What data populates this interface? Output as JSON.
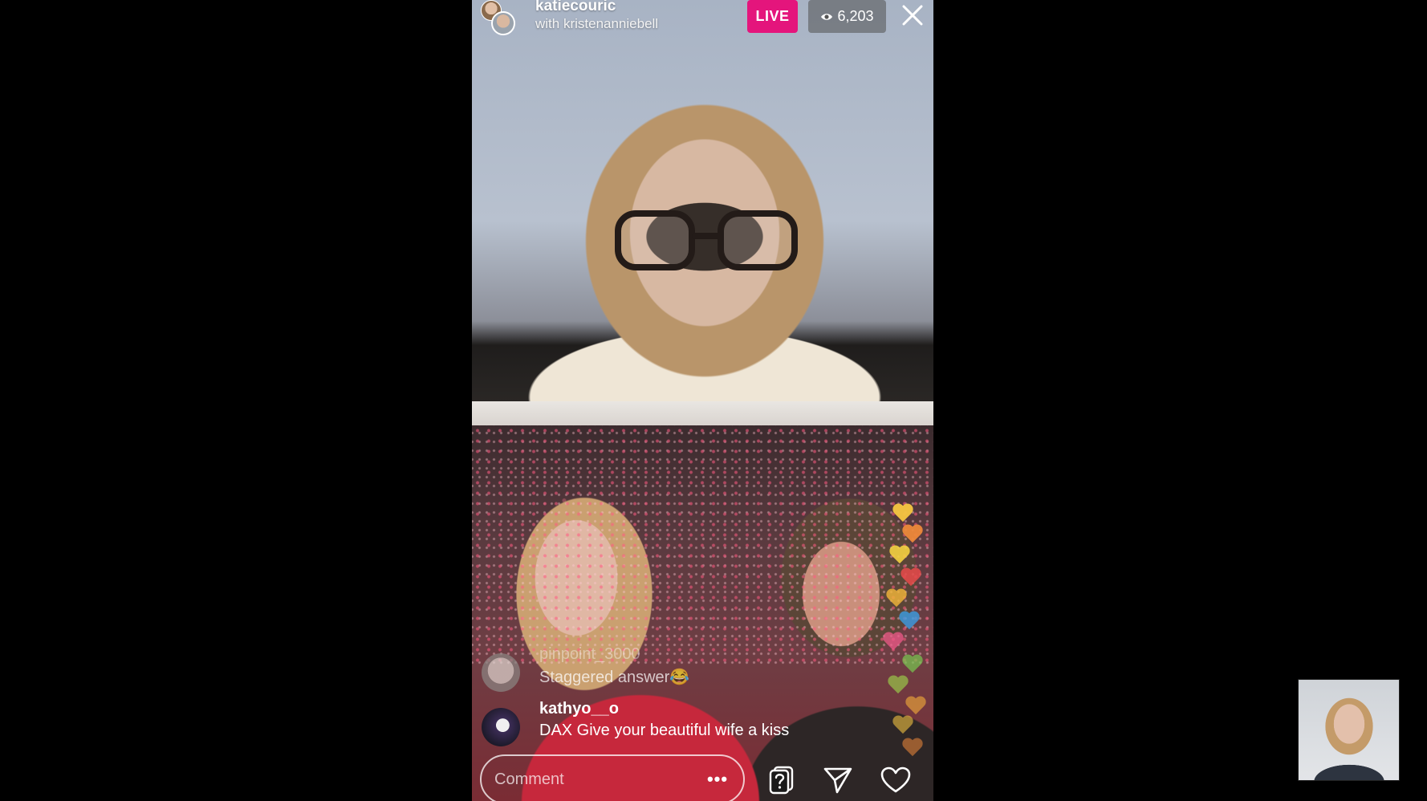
{
  "stream": {
    "host_username": "katiecouric",
    "with_line": "with kristenanniebell",
    "live_label": "LIVE",
    "viewer_count": "6,203"
  },
  "comments": [
    {
      "username": "pinpoint_3000",
      "text": "Staggered answer😂"
    },
    {
      "username": "kathyo__o",
      "text": "DAX Give your beautiful wife a kiss"
    }
  ],
  "composer": {
    "placeholder": "Comment",
    "more_label": "•••"
  },
  "icons": {
    "close": "close-icon",
    "eye": "eye-icon",
    "question": "question-icon",
    "share": "paper-plane-icon",
    "like": "heart-icon"
  },
  "colors": {
    "live_badge": "#e4157c",
    "background": "#000000",
    "text": "#ffffff"
  },
  "hearts": [
    "#f28a3a",
    "#f5c542",
    "#f0a93a",
    "#9ccf4a",
    "#78c850",
    "#f05a8a",
    "#3aa0e8",
    "#f2b63a",
    "#e84a4a",
    "#f5d342",
    "#f08a3a",
    "#f5c542"
  ]
}
